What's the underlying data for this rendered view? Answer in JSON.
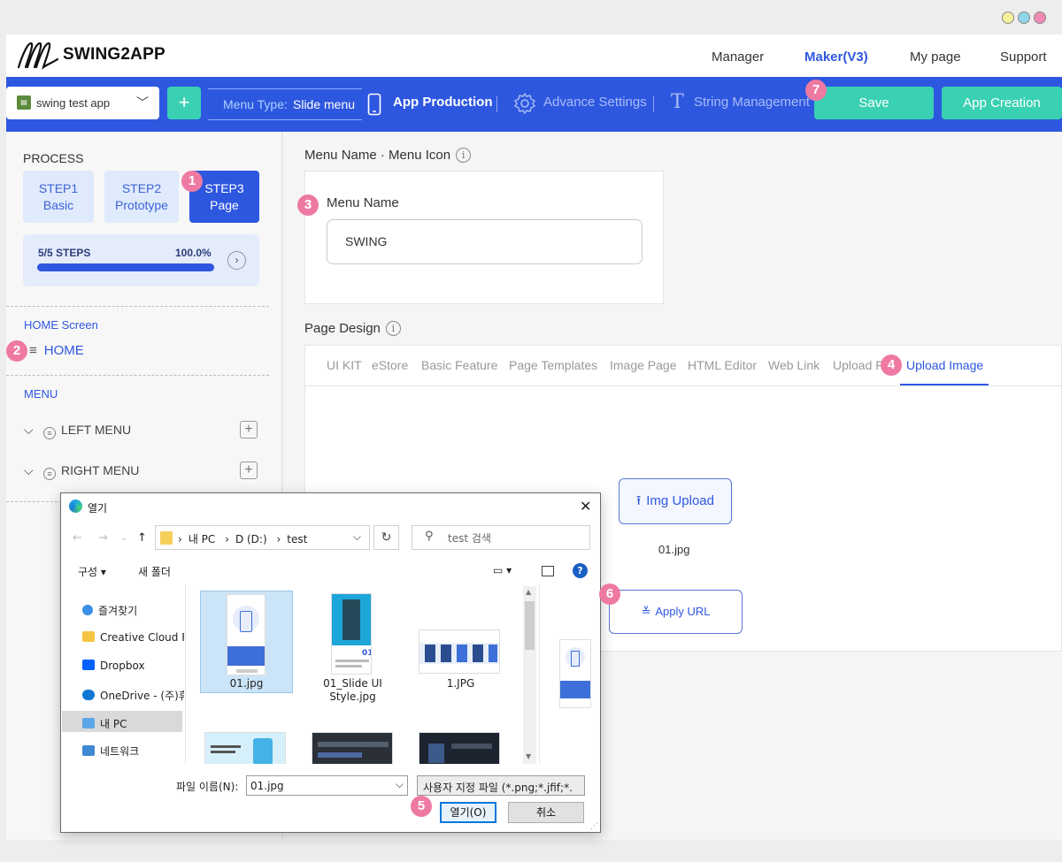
{
  "window": {
    "dot_colors": [
      "#f3ef9a",
      "#8fd6e8",
      "#f08ab4"
    ]
  },
  "header": {
    "brand": "SWING2APP",
    "nav": [
      "Manager",
      "Maker(V3)",
      "My page",
      "Support"
    ]
  },
  "toolbar": {
    "app_select": "swing test app",
    "add_button": "+",
    "menu_type_label": "Menu Type:",
    "menu_type_value": "Slide menu",
    "app_production": "App Production",
    "advance_settings": "Advance Settings",
    "string_management": "String Management",
    "save": "Save",
    "app_creation": "App Creation"
  },
  "sidebar": {
    "process_label": "PROCESS",
    "steps": [
      {
        "line1": "STEP1",
        "line2": "Basic"
      },
      {
        "line1": "STEP2",
        "line2": "Prototype"
      },
      {
        "line1": "STEP3",
        "line2": "Page"
      }
    ],
    "progress": {
      "label": "5/5 STEPS",
      "percent_text": "100.0%",
      "fraction": 1.0
    },
    "home_screen_label": "HOME Screen",
    "home_item": "HOME",
    "menu_label": "MENU",
    "menus": [
      "LEFT MENU",
      "RIGHT MENU"
    ]
  },
  "main": {
    "menu_name_section": "Menu Name · Menu Icon",
    "menu_name_label": "Menu Name",
    "menu_name_value": "SWING",
    "page_design_section": "Page Design",
    "tabs": [
      "UI KIT",
      "eStore",
      "Basic Feature",
      "Page Templates",
      "Image Page",
      "HTML Editor",
      "Web Link",
      "Upload F",
      "Upload Image"
    ],
    "img_upload": "Img Upload",
    "file_name": "01.jpg",
    "apply_url": "Apply URL"
  },
  "badges": [
    "1",
    "2",
    "3",
    "4",
    "5",
    "6",
    "7"
  ],
  "dialog": {
    "title": "열기",
    "address": [
      "내 PC",
      "D (D:)",
      "test"
    ],
    "search_placeholder": "test 검색",
    "organize": "구성",
    "new_folder": "새 폴더",
    "nav": [
      "즐겨찾기",
      "Creative Cloud Fi",
      "Dropbox",
      "OneDrive - (주)휴",
      "내 PC",
      "네트워크"
    ],
    "files": [
      "01.jpg",
      "01_Slide UI Style.jpg",
      "1.JPG"
    ],
    "file_name_label": "파일 이름(N):",
    "file_name_value": "01.jpg",
    "file_type": "사용자 지정 파일 (*.png;*.jfif;*.",
    "open": "열기(O)",
    "cancel": "취소"
  }
}
